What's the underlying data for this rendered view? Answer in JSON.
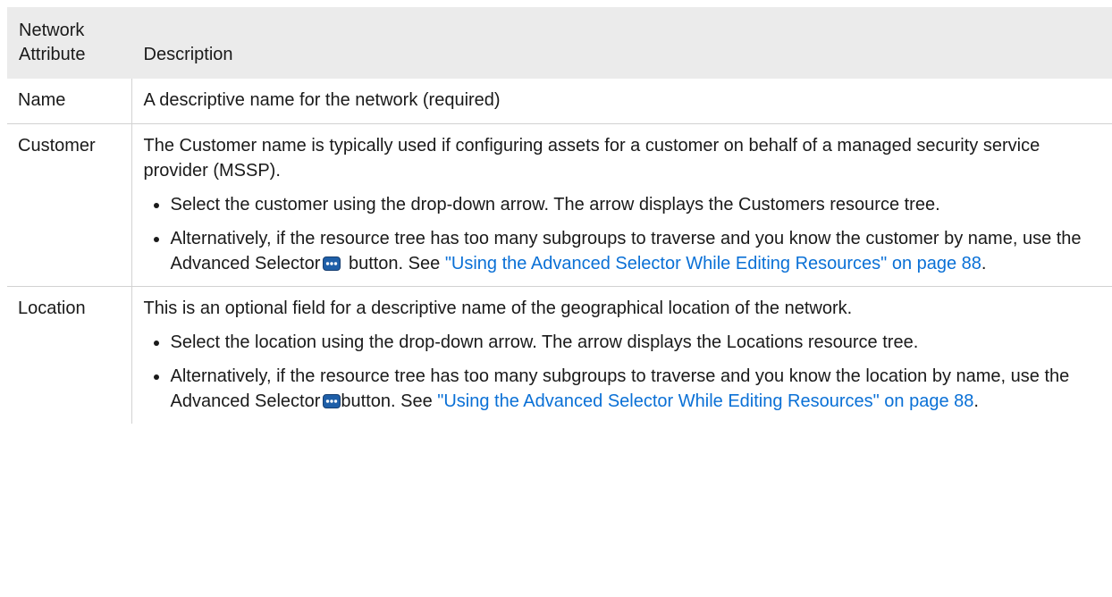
{
  "table": {
    "header": {
      "attr_line1": "Network",
      "attr_line2": "Attribute",
      "description": "Description"
    },
    "rows": [
      {
        "attribute": "Name",
        "description": "A descriptive name for the network (required)"
      },
      {
        "attribute": "Customer",
        "intro": "The Customer name is typically used if configuring assets for a customer on behalf of a managed security service provider (MSSP).",
        "bullet1": "Select the customer using the drop-down arrow. The arrow displays the Customers resource tree.",
        "bullet2_before": "Alternatively, if the resource tree has too many subgroups to traverse and you know the customer by name, use the Advanced Selector",
        "bullet2_after": " button. See ",
        "link": "\"Using the Advanced Selector While Editing Resources\" on page 88",
        "bullet2_end": "."
      },
      {
        "attribute": "Location",
        "intro": "This is an optional field for a descriptive name of the geographical location of the network.",
        "bullet1": "Select the location using the drop-down arrow. The arrow displays the Locations resource tree.",
        "bullet2_before": "Alternatively, if the resource tree has too many subgroups to traverse and you know the location by name, use the Advanced Selector",
        "bullet2_after": "button. See ",
        "link": "\"Using the Advanced Selector While Editing Resources\" on page 88",
        "bullet2_end": "."
      }
    ]
  },
  "icons": {
    "advanced_selector": "ellipsis-button-icon"
  },
  "colors": {
    "header_bg": "#ebebeb",
    "link": "#0a70d6",
    "rule": "#d2d2d2"
  }
}
